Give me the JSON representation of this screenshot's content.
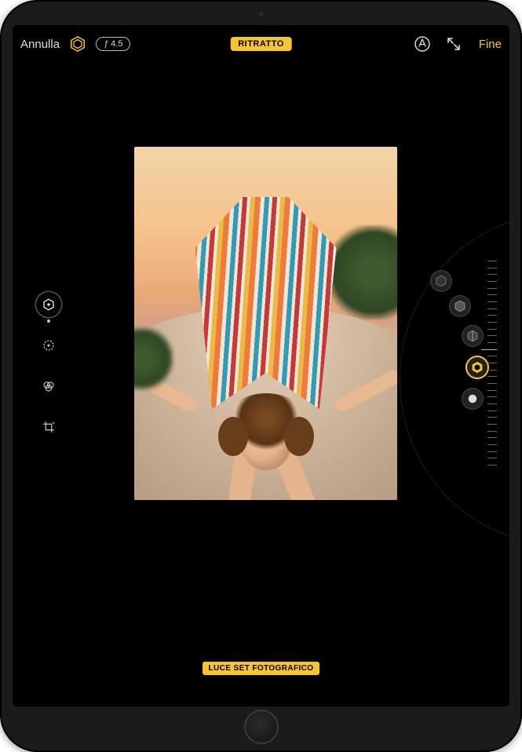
{
  "topbar": {
    "cancel": "Annulla",
    "fstop_prefix": "ƒ",
    "fstop_value": "4.5",
    "mode": "RITRATTO",
    "done": "Fine"
  },
  "left_tools": [
    {
      "id": "portrait-lighting",
      "icon": "hexagon-icon",
      "active": true
    },
    {
      "id": "adjust",
      "icon": "adjust-icon",
      "active": false
    },
    {
      "id": "filters",
      "icon": "filters-icon",
      "active": false
    },
    {
      "id": "crop",
      "icon": "crop-icon",
      "active": false
    }
  ],
  "lighting_options": [
    {
      "id": "natural",
      "selected": false
    },
    {
      "id": "studio",
      "selected": false
    },
    {
      "id": "contour",
      "selected": false
    },
    {
      "id": "stage",
      "selected": true
    },
    {
      "id": "stage-mono",
      "selected": false
    }
  ],
  "lighting_label": "LUCE SET FOTOGRAFICO",
  "icons": {
    "portrait_hex": "hexagon-icon",
    "markup": "markup-icon",
    "expand": "expand-icon"
  }
}
